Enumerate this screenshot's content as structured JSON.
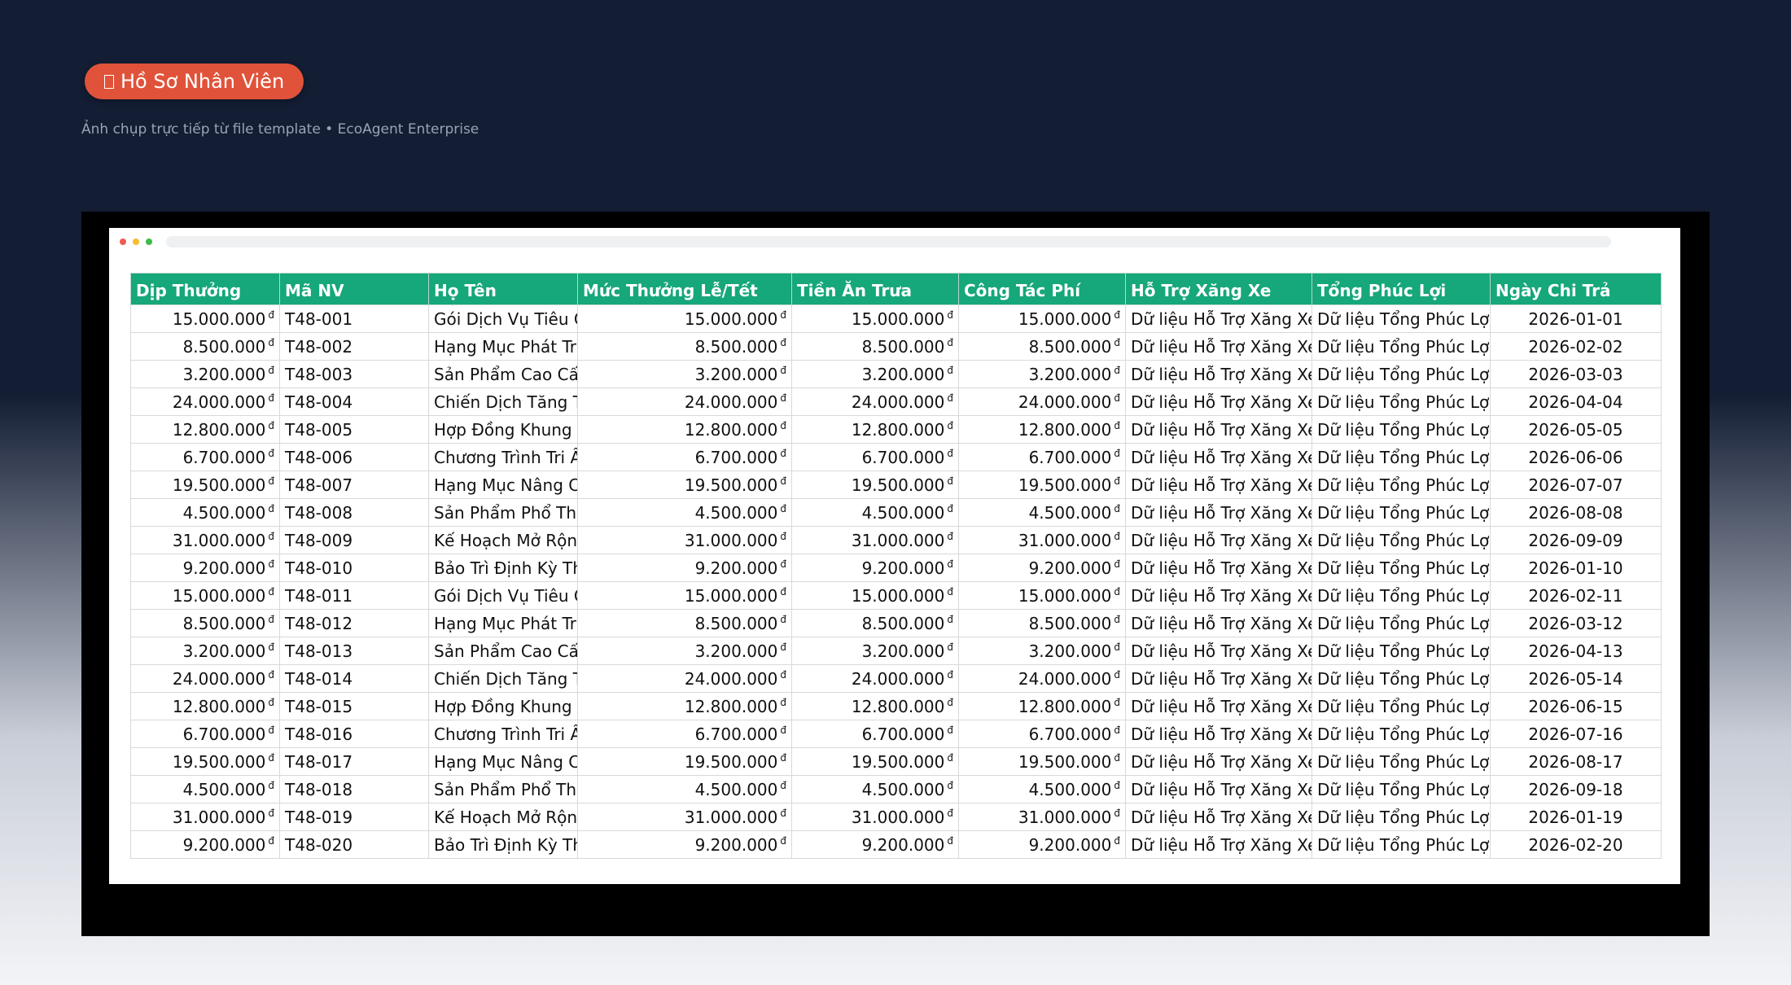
{
  "header": {
    "badge_label": "Hồ Sơ Nhân Viên",
    "badge_icon": "document-icon",
    "subtitle": "Ảnh chụp trực tiếp từ file template • EcoAgent Enterprise"
  },
  "colors": {
    "badge": "#e0533a",
    "header_row": "#16a77a",
    "background": "#131d33"
  },
  "table": {
    "currency_symbol": "đ",
    "columns": [
      "Dịp Thưởng",
      "Mã NV",
      "Họ Tên",
      "Mức Thưởng Lễ/Tết",
      "Tiền Ăn Trưa",
      "Công Tác Phí",
      "Hỗ Trợ Xăng Xe",
      "Tổng Phúc Lợi",
      "Ngày Chi Trả"
    ],
    "rows": [
      [
        "15.000.000",
        "T48-001",
        "Gói Dịch Vụ Tiêu Chuẩn",
        "15.000.000",
        "15.000.000",
        "15.000.000",
        "Dữ liệu Hỗ Trợ Xăng Xe",
        "Dữ liệu Tổng Phúc Lợi",
        "2026-01-01"
      ],
      [
        "8.500.000",
        "T48-002",
        "Hạng Mục Phát Triển",
        "8.500.000",
        "8.500.000",
        "8.500.000",
        "Dữ liệu Hỗ Trợ Xăng Xe",
        "Dữ liệu Tổng Phúc Lợi",
        "2026-02-02"
      ],
      [
        "3.200.000",
        "T48-003",
        "Sản Phẩm Cao Cấp",
        "3.200.000",
        "3.200.000",
        "3.200.000",
        "Dữ liệu Hỗ Trợ Xăng Xe",
        "Dữ liệu Tổng Phúc Lợi",
        "2026-03-03"
      ],
      [
        "24.000.000",
        "T48-004",
        "Chiến Dịch Tăng Trưởng",
        "24.000.000",
        "24.000.000",
        "24.000.000",
        "Dữ liệu Hỗ Trợ Xăng Xe",
        "Dữ liệu Tổng Phúc Lợi",
        "2026-04-04"
      ],
      [
        "12.800.000",
        "T48-005",
        "Hợp Đồng Khung Quý",
        "12.800.000",
        "12.800.000",
        "12.800.000",
        "Dữ liệu Hỗ Trợ Xăng Xe",
        "Dữ liệu Tổng Phúc Lợi",
        "2026-05-05"
      ],
      [
        "6.700.000",
        "T48-006",
        "Chương Trình Tri Ân",
        "6.700.000",
        "6.700.000",
        "6.700.000",
        "Dữ liệu Hỗ Trợ Xăng Xe",
        "Dữ liệu Tổng Phúc Lợi",
        "2026-06-06"
      ],
      [
        "19.500.000",
        "T48-007",
        "Hạng Mục Nâng Cấp",
        "19.500.000",
        "19.500.000",
        "19.500.000",
        "Dữ liệu Hỗ Trợ Xăng Xe",
        "Dữ liệu Tổng Phúc Lợi",
        "2026-07-07"
      ],
      [
        "4.500.000",
        "T48-008",
        "Sản Phẩm Phổ Thông",
        "4.500.000",
        "4.500.000",
        "4.500.000",
        "Dữ liệu Hỗ Trợ Xăng Xe",
        "Dữ liệu Tổng Phúc Lợi",
        "2026-08-08"
      ],
      [
        "31.000.000",
        "T48-009",
        "Kế Hoạch Mở Rộng",
        "31.000.000",
        "31.000.000",
        "31.000.000",
        "Dữ liệu Hỗ Trợ Xăng Xe",
        "Dữ liệu Tổng Phúc Lợi",
        "2026-09-09"
      ],
      [
        "9.200.000",
        "T48-010",
        "Bảo Trì Định Kỳ Tháng",
        "9.200.000",
        "9.200.000",
        "9.200.000",
        "Dữ liệu Hỗ Trợ Xăng Xe",
        "Dữ liệu Tổng Phúc Lợi",
        "2026-01-10"
      ],
      [
        "15.000.000",
        "T48-011",
        "Gói Dịch Vụ Tiêu Chuẩn",
        "15.000.000",
        "15.000.000",
        "15.000.000",
        "Dữ liệu Hỗ Trợ Xăng Xe",
        "Dữ liệu Tổng Phúc Lợi",
        "2026-02-11"
      ],
      [
        "8.500.000",
        "T48-012",
        "Hạng Mục Phát Triển",
        "8.500.000",
        "8.500.000",
        "8.500.000",
        "Dữ liệu Hỗ Trợ Xăng Xe",
        "Dữ liệu Tổng Phúc Lợi",
        "2026-03-12"
      ],
      [
        "3.200.000",
        "T48-013",
        "Sản Phẩm Cao Cấp",
        "3.200.000",
        "3.200.000",
        "3.200.000",
        "Dữ liệu Hỗ Trợ Xăng Xe",
        "Dữ liệu Tổng Phúc Lợi",
        "2026-04-13"
      ],
      [
        "24.000.000",
        "T48-014",
        "Chiến Dịch Tăng Trưởng",
        "24.000.000",
        "24.000.000",
        "24.000.000",
        "Dữ liệu Hỗ Trợ Xăng Xe",
        "Dữ liệu Tổng Phúc Lợi",
        "2026-05-14"
      ],
      [
        "12.800.000",
        "T48-015",
        "Hợp Đồng Khung Quý",
        "12.800.000",
        "12.800.000",
        "12.800.000",
        "Dữ liệu Hỗ Trợ Xăng Xe",
        "Dữ liệu Tổng Phúc Lợi",
        "2026-06-15"
      ],
      [
        "6.700.000",
        "T48-016",
        "Chương Trình Tri Ân",
        "6.700.000",
        "6.700.000",
        "6.700.000",
        "Dữ liệu Hỗ Trợ Xăng Xe",
        "Dữ liệu Tổng Phúc Lợi",
        "2026-07-16"
      ],
      [
        "19.500.000",
        "T48-017",
        "Hạng Mục Nâng Cấp",
        "19.500.000",
        "19.500.000",
        "19.500.000",
        "Dữ liệu Hỗ Trợ Xăng Xe",
        "Dữ liệu Tổng Phúc Lợi",
        "2026-08-17"
      ],
      [
        "4.500.000",
        "T48-018",
        "Sản Phẩm Phổ Thông",
        "4.500.000",
        "4.500.000",
        "4.500.000",
        "Dữ liệu Hỗ Trợ Xăng Xe",
        "Dữ liệu Tổng Phúc Lợi",
        "2026-09-18"
      ],
      [
        "31.000.000",
        "T48-019",
        "Kế Hoạch Mở Rộng",
        "31.000.000",
        "31.000.000",
        "31.000.000",
        "Dữ liệu Hỗ Trợ Xăng Xe",
        "Dữ liệu Tổng Phúc Lợi",
        "2026-01-19"
      ],
      [
        "9.200.000",
        "T48-020",
        "Bảo Trì Định Kỳ Tháng",
        "9.200.000",
        "9.200.000",
        "9.200.000",
        "Dữ liệu Hỗ Trợ Xăng Xe",
        "Dữ liệu Tổng Phúc Lợi",
        "2026-02-20"
      ]
    ]
  }
}
